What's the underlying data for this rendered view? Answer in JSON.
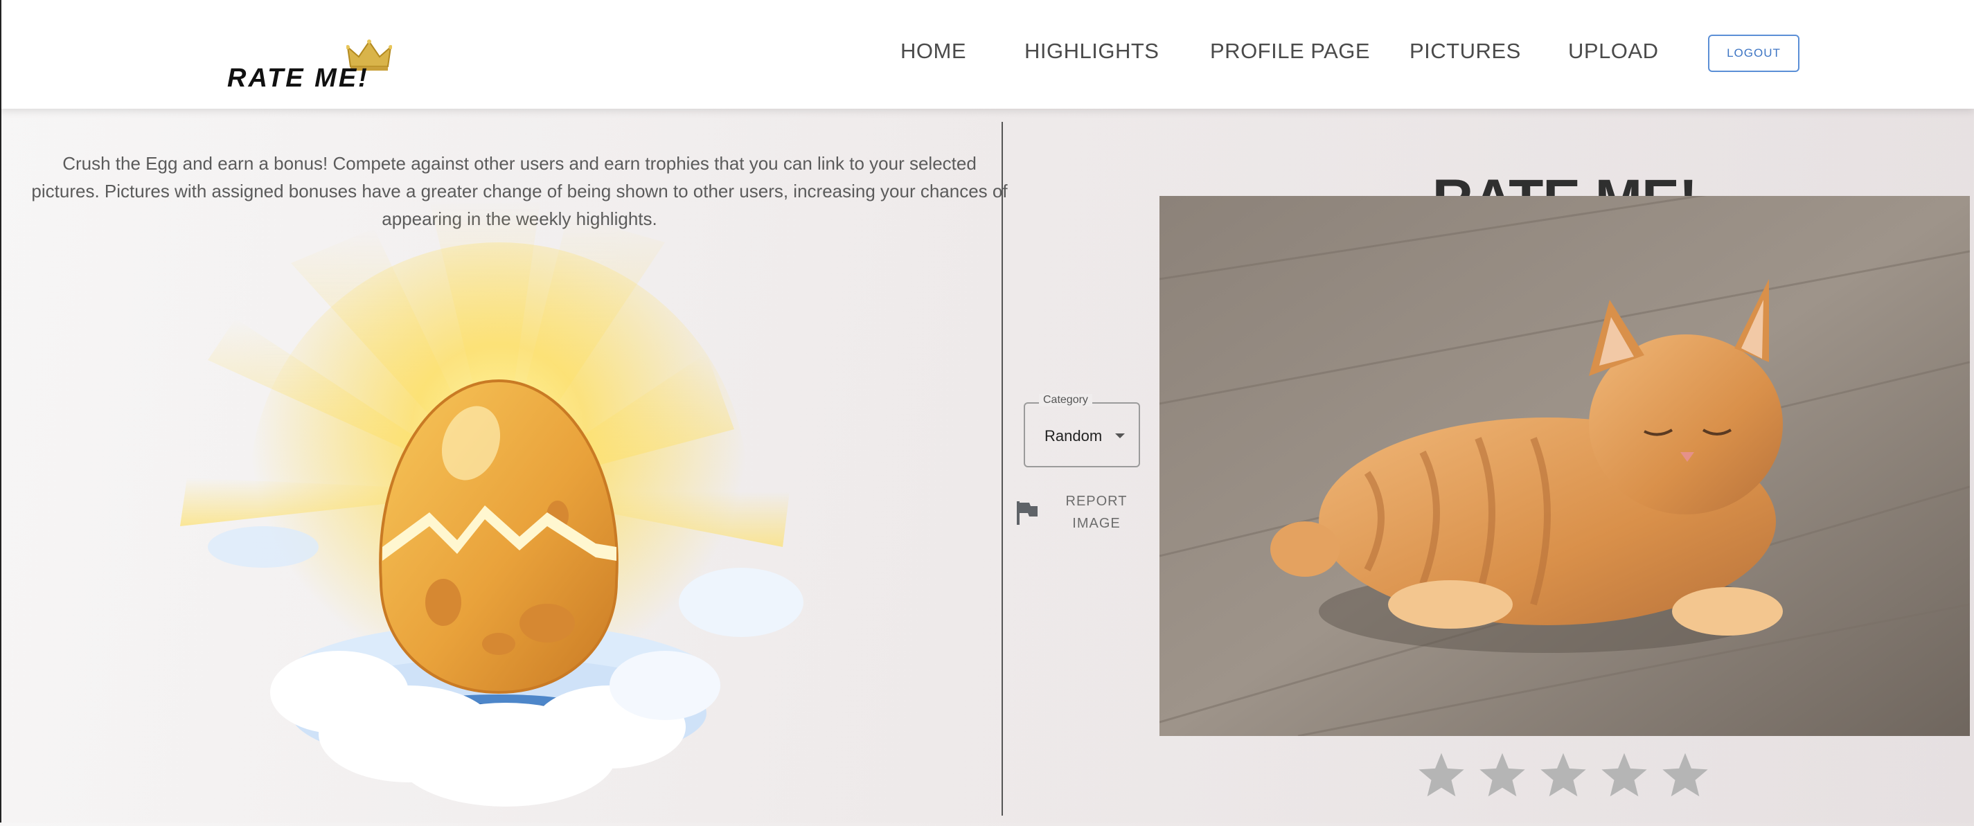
{
  "header": {
    "logo_text": "RATE ME!",
    "nav": [
      {
        "label": "HOME"
      },
      {
        "label": "HIGHLIGHTS"
      },
      {
        "label": "PROFILE PAGE"
      },
      {
        "label": "PICTURES"
      },
      {
        "label": "UPLOAD"
      }
    ],
    "logout_label": "LOGOUT"
  },
  "intro": {
    "text": "Crush the Egg and earn a bonus! Compete against other users and earn trophies that you can link to your selected pictures. Pictures with assigned bonuses have a greater change of being shown to other users, increasing your chances of appearing in the weekly highlights."
  },
  "rate": {
    "title": "RATE ME!",
    "category": {
      "label": "Category",
      "value": "Random"
    },
    "report_label": "REPORT IMAGE",
    "stars_filled": 0,
    "stars_total": 5
  },
  "colors": {
    "accent": "#3f76c4",
    "star": "#b5b5b5",
    "egg": "#e9a23b"
  },
  "icons": [
    "crown-icon",
    "flag-icon",
    "star-icon",
    "caret-down-icon"
  ]
}
